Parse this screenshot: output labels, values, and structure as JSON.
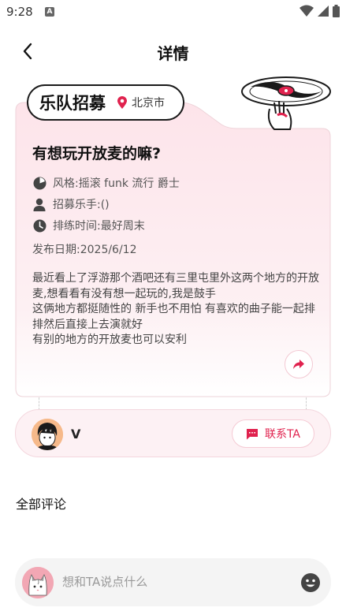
{
  "status_bar": {
    "time": "9:28",
    "app_icon_letter": "A",
    "icons": [
      "wifi-icon",
      "signal-icon",
      "battery-icon"
    ]
  },
  "header": {
    "title": "详情",
    "back_icon": "chevron-left-icon"
  },
  "card": {
    "tag_title": "乐队招募",
    "location": "北京市",
    "post_title": "有想玩开放麦的嘛?",
    "style_text": "风格:摇滚 funk 流行 爵士",
    "recruit_text": "招募乐手:()",
    "rehearsal_text": "排练时间:最好周末",
    "date_text": "发布日期:2025/6/12",
    "body": "最近看上了浮游那个酒吧还有三里屯里外这两个地方的开放麦,想看看有没有想一起玩的,我是鼓手\n这俩地方都挺随性的 新手也不用怕 有喜欢的曲子能一起排排然后直接上去演就好\n有别的地方的开放麦也可以安利",
    "accent_color": "#e0224e",
    "icons": [
      "location-pin-icon",
      "music-note-icon",
      "person-icon",
      "clock-icon",
      "share-icon",
      "vinyl-record-icon"
    ]
  },
  "user": {
    "name": "V",
    "contact_label": "联系TA",
    "contact_icon": "chat-bubble-icon"
  },
  "comments": {
    "title": "全部评论"
  },
  "comment_bar": {
    "placeholder": "想和TA说点什么",
    "emoji_icon": "smiley-icon"
  }
}
